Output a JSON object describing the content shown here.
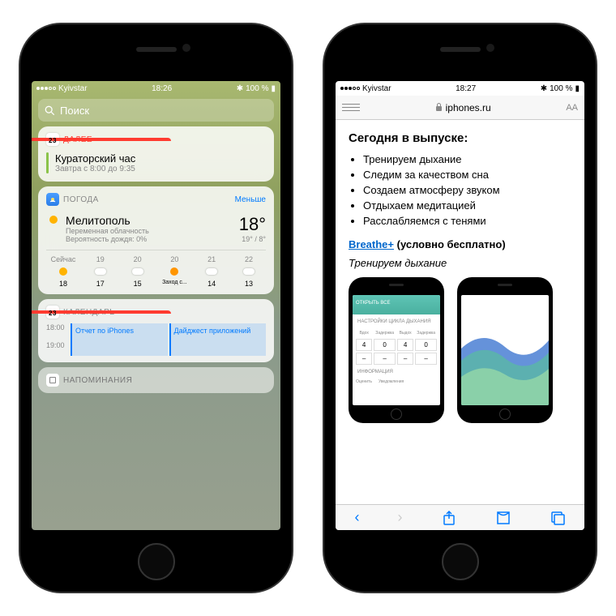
{
  "status": {
    "carrier": "Kyivstar",
    "battery": "100 %"
  },
  "phone1": {
    "time": "18:26",
    "search_placeholder": "Поиск",
    "upnext": {
      "header": "ДАЛЕЕ",
      "title": "Кураторский час",
      "time": "Завтра с 8:00 до 9:35",
      "icon_day": "23"
    },
    "weather": {
      "header": "ПОГОДА",
      "less": "Меньше",
      "city": "Мелитополь",
      "cond1": "Переменная облачность",
      "cond2": "Вероятность дождя: 0%",
      "temp": "18°",
      "hi": "19°",
      "lo": "8°",
      "hours": [
        {
          "h": "Сейчас",
          "t": "18"
        },
        {
          "h": "19",
          "t": "17"
        },
        {
          "h": "20",
          "t": "15"
        },
        {
          "h": "20",
          "t": "Заход с..."
        },
        {
          "h": "21",
          "t": "14"
        },
        {
          "h": "22",
          "t": "13"
        }
      ]
    },
    "calendar": {
      "header": "КАЛЕНДАРЬ",
      "icon_day": "23",
      "t1": "18:00",
      "t2": "19:00",
      "ev1": "Отчет по iPhones",
      "ev2": "Дайджест приложений"
    },
    "reminders": {
      "header": "НАПОМИНАНИЯ"
    }
  },
  "phone2": {
    "time": "18:27",
    "url": "iphones.ru",
    "aa": "AA",
    "title": "Сегодня в выпуске:",
    "items": [
      "Тренируем дыхание",
      "Следим за качеством сна",
      "Создаем атмосферу звуком",
      "Отдыхаем медитацией",
      "Расслабляемся с тенями"
    ],
    "app_link": "Breathe+",
    "app_note": "(условно бесплатно)",
    "subtitle": "Тренируем дыхание",
    "mini1": {
      "banner": "ОТКРЫТЬ ВСЕ",
      "sec1": "НАСТРОЙКИ ЦИКЛА ДЫХАНИЯ",
      "labels": [
        "Вдох",
        "Задержка",
        "Выдох",
        "Задержка"
      ],
      "vals": [
        "4",
        "0",
        "4",
        "0"
      ],
      "sec2": "ИНФОРМАЦИЯ",
      "b1": "Оценить",
      "b2": "Уведомления"
    }
  }
}
